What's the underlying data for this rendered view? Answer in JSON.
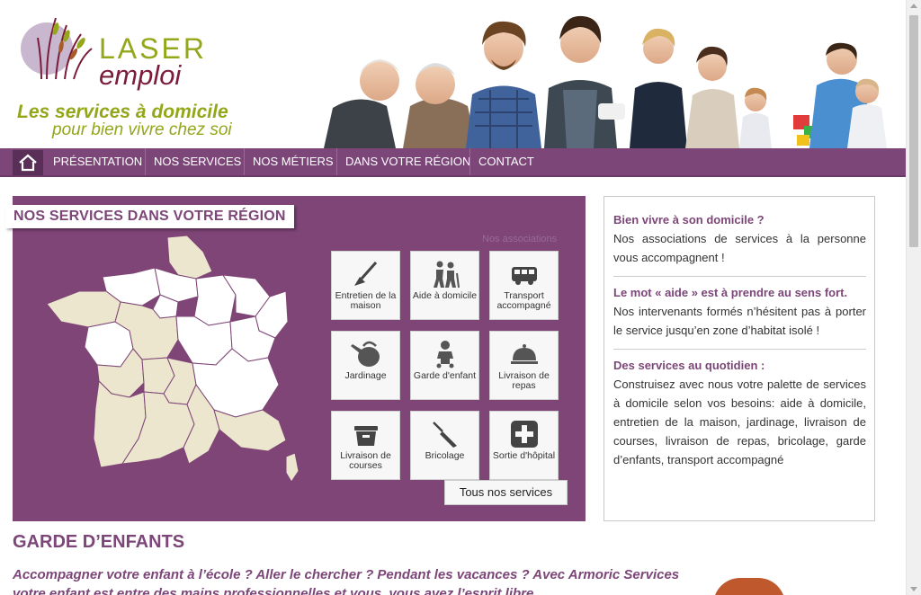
{
  "logo": {
    "line1": "LASER",
    "line2": "emploi"
  },
  "tagline": {
    "line1": "Les services à domicile",
    "line2": "pour bien vivre chez soi"
  },
  "colors": {
    "brand_purple": "#7c4678",
    "brand_green": "#94a619",
    "brand_wine": "#7b1d3a"
  },
  "nav": {
    "home_icon": "home-icon",
    "items": [
      {
        "label": "PRÉSENTATION"
      },
      {
        "label": "NOS SERVICES"
      },
      {
        "label": "NOS MÉTIERS"
      },
      {
        "label": "DANS VOTRE RÉGION"
      },
      {
        "label": "CONTACT"
      }
    ]
  },
  "services_box": {
    "title": "NOS SERVICES DANS VOTRE RÉGION",
    "faded_label": "Nos associations",
    "tiles": [
      {
        "label": "Entretien de la maison",
        "icon": "broom-icon"
      },
      {
        "label": "Aide à domicile",
        "icon": "elderly-couple-icon"
      },
      {
        "label": "Transport accompagné",
        "icon": "bus-icon"
      },
      {
        "label": "Jardinage",
        "icon": "watering-can-icon"
      },
      {
        "label": "Garde d'enfant",
        "icon": "baby-icon"
      },
      {
        "label": "Livraison de repas",
        "icon": "cloche-icon"
      },
      {
        "label": "Livraison de courses",
        "icon": "basket-icon"
      },
      {
        "label": "Bricolage",
        "icon": "screwdriver-icon"
      },
      {
        "label": "Sortie d'hôpital",
        "icon": "medical-cross-icon"
      }
    ],
    "all_button": "Tous nos services"
  },
  "sidebar": {
    "sections": [
      {
        "heading": "Bien vivre à son domicile ?",
        "text": "Nos associations de services à la personne vous accompagnent !"
      },
      {
        "heading": "Le mot «  aide  » est à prendre au sens fort.",
        "text": "Nos intervenants formés n’hésitent pas à porter le service jusqu’en zone d’habitat isolé !"
      },
      {
        "heading": "Des services au quotidien :",
        "text": "Construisez avec nous votre palette de services à domicile selon vos besoins: aide à domicile, entretien de la maison, jardinage, livraison de courses, livraison de repas, bricolage, garde d’enfants, transport accompagné"
      }
    ]
  },
  "garde": {
    "title": "GARDE D’ENFANTS",
    "text": "Accompagner votre enfant à l’école ? Aller le chercher ? Pendant les vacances ? Avec Armoric Services votre enfant est entre des mains professionnelles et vous, vous avez l’esprit libre."
  }
}
